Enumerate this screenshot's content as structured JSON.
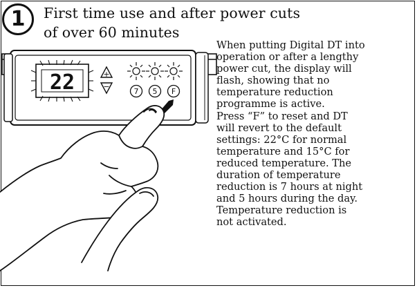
{
  "step": {
    "number": "1"
  },
  "heading": {
    "line1": "First time use and after power cuts",
    "line2": "of over 60 minutes"
  },
  "body_text": "When putting Digital DT into\noperation or after a lengthy\npower cut, the display will\nflash, showing that no\ntemperature reduction\nprogramme is active.\nPress “F” to reset and DT\nwill revert to the default\nsettings: 22°C for normal\ntemperature and 15°C for\nreduced temperature. The\nduration of temperature\nreduction is 7 hours at night\nand 5 hours during the day.\nTemperature reduction is\nnot activated.",
  "device": {
    "display_value": "22",
    "buttons": [
      "7",
      "5",
      "F"
    ],
    "icons": [
      "plus-minus-arrow-icon",
      "sun-icon",
      "sun-icon",
      "sun-icon",
      "hand-icon",
      "arrow-icon"
    ]
  }
}
